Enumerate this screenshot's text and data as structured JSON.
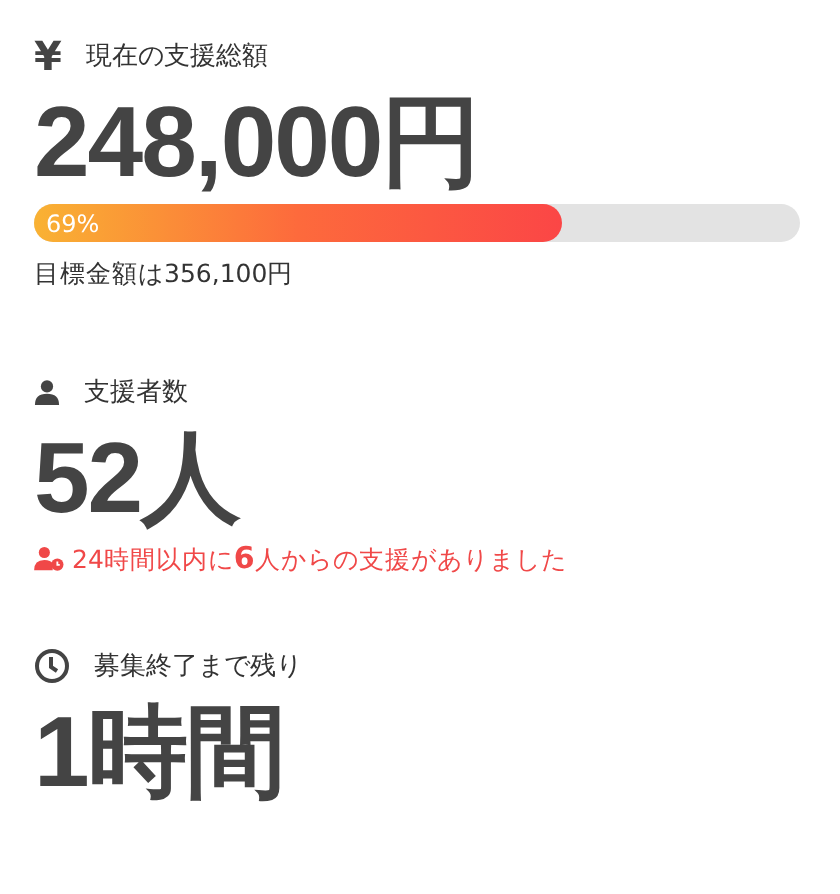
{
  "sections": [
    {
      "kind": "amount",
      "icon_text": "¥",
      "label": "現在の支援総額",
      "value": "248,000円",
      "progress": {
        "level": 0.69,
        "label": "69%"
      },
      "goal": "目標金額は356,100円"
    },
    {
      "kind": "supporters",
      "label": "支援者数",
      "value": "52人",
      "note": "24時間以内に**6**人からの支援がありました"
    },
    {
      "kind": "time",
      "label": "募集終了まで残り",
      "value": "1時間"
    }
  ]
}
